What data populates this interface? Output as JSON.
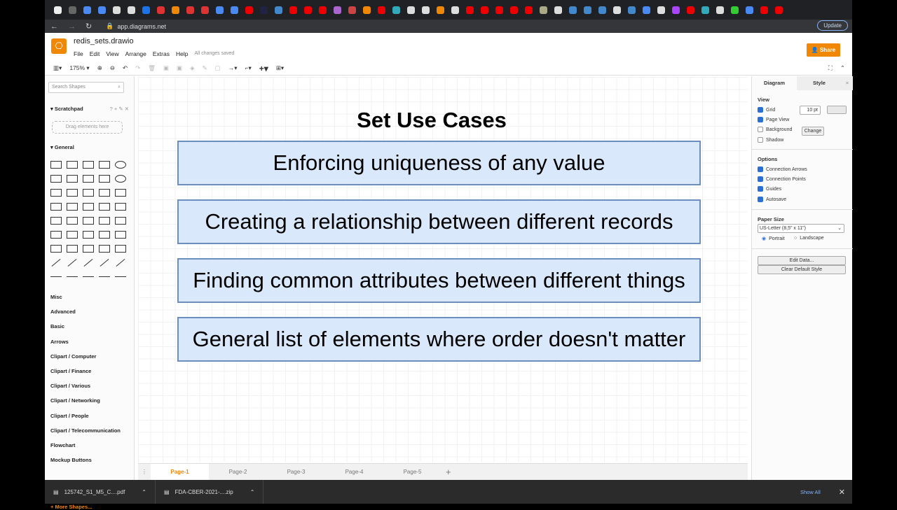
{
  "browser": {
    "url": "app.diagrams.net",
    "update_label": "Update",
    "favicon_colors": [
      "#eee",
      "#666",
      "#4a8af4",
      "#4a8af4",
      "#ddd",
      "#ddd",
      "#1a73e8",
      "#d33",
      "#f08705",
      "#d33",
      "#d33",
      "#4a8af4",
      "#4a8af4",
      "#e00",
      "#224",
      "#48c",
      "#e00",
      "#e00",
      "#e00",
      "#a6c",
      "#c44",
      "#f08705",
      "#e00",
      "#3ab",
      "#ddd",
      "#ddd",
      "#f08705",
      "#ddd",
      "#e00",
      "#e00",
      "#e00",
      "#e00",
      "#e00",
      "#aa8",
      "#ddd",
      "#48c",
      "#48c",
      "#48c",
      "#ddd",
      "#48c",
      "#4a8af4",
      "#ddd",
      "#a4f",
      "#e00",
      "#3ab",
      "#ddd",
      "#3c3",
      "#4a8af4",
      "#e00",
      "#e00"
    ]
  },
  "app": {
    "file_title": "redis_sets.drawio",
    "menu": [
      "File",
      "Edit",
      "View",
      "Arrange",
      "Extras",
      "Help"
    ],
    "save_status": "All changes saved",
    "share_label": "Share",
    "zoom": "175%"
  },
  "sidebar": {
    "search_placeholder": "Search Shapes",
    "scratchpad": "Scratchpad",
    "drag_hint": "Drag elements here",
    "general": "General",
    "categories": [
      "Misc",
      "Advanced",
      "Basic",
      "Arrows",
      "Clipart / Computer",
      "Clipart / Finance",
      "Clipart / Various",
      "Clipart / Networking",
      "Clipart / People",
      "Clipart / Telecommunication",
      "Flowchart",
      "Mockup Buttons"
    ],
    "more_shapes": "+ More Shapes..."
  },
  "diagram": {
    "title": "Set Use Cases",
    "box_fill": "#dae8fc",
    "box_stroke": "#6c8ebf",
    "boxes": [
      "Enforcing uniqueness of any value",
      "Creating a relationship between different records",
      "Finding common attributes between different things",
      "General list of elements where order doesn't matter"
    ]
  },
  "pages": [
    "Page-1",
    "Page-2",
    "Page-3",
    "Page-4",
    "Page-5"
  ],
  "active_page": "Page-1",
  "format_panel": {
    "tabs": [
      "Diagram",
      "Style"
    ],
    "view_heading": "View",
    "grid_label": "Grid",
    "grid_size": "10 pt",
    "page_view": "Page View",
    "background": "Background",
    "change_label": "Change",
    "shadow": "Shadow",
    "options_heading": "Options",
    "options": [
      "Connection Arrows",
      "Connection Points",
      "Guides",
      "Autosave"
    ],
    "paper_size_heading": "Paper Size",
    "paper_size": "US-Letter (8,5\" x 11\")",
    "portrait": "Portrait",
    "landscape": "Landscape",
    "edit_data": "Edit Data...",
    "clear_style": "Clear Default Style"
  },
  "downloads": {
    "items": [
      "125742_S1_M5_C....pdf",
      "FDA-CBER-2021-....zip"
    ],
    "show_all": "Show All"
  }
}
